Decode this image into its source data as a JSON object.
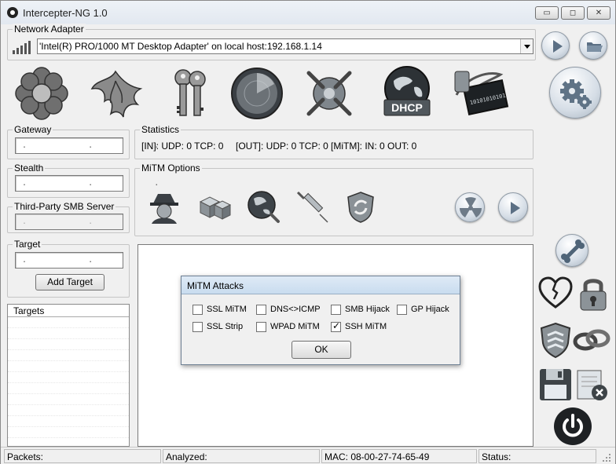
{
  "window": {
    "title": "Intercepter-NG 1.0",
    "controls": {
      "minimize_glyph": "▭",
      "maximize_glyph": "◻",
      "close_glyph": "✕"
    }
  },
  "network_adapter": {
    "label": "Network Adapter",
    "selected": "'Intel(R) PRO/1000 MT Desktop Adapter' on local host:192.168.1.14"
  },
  "ip_placeholder": ".      .      .",
  "gateway": {
    "label": "Gateway"
  },
  "stealth": {
    "label": "Stealth"
  },
  "third_party": {
    "label": "Third-Party SMB Server"
  },
  "target": {
    "label": "Target",
    "add_button": "Add Target"
  },
  "statistics": {
    "label": "Statistics",
    "in_text": "[IN]: UDP: 0 TCP: 0",
    "out_text": "[OUT]: UDP: 0 TCP: 0",
    "mitm_text": "[MiTM]: IN: 0 OUT: 0"
  },
  "mitm_options": {
    "label": "MiTM Options"
  },
  "targets_list": {
    "header": "Targets"
  },
  "dhcp_label": "DHCP",
  "binary_text": "10101010101",
  "status": {
    "packets": "Packets:",
    "analyzed": "Analyzed:",
    "mac": "MAC: 08-00-27-74-65-49",
    "status": "Status:"
  },
  "dialog": {
    "title": "MiTM Attacks",
    "options": [
      {
        "label": "SSL MiTM",
        "checked": false
      },
      {
        "label": "DNS<>ICMP",
        "checked": false
      },
      {
        "label": "SMB Hijack",
        "checked": false
      },
      {
        "label": "GP Hijack",
        "checked": false
      },
      {
        "label": "SSL Strip",
        "checked": false
      },
      {
        "label": "WPAD MiTM",
        "checked": false
      },
      {
        "label": "SSH MiTM",
        "checked": true
      }
    ],
    "ok_label": "OK",
    "check_glyph": "✓"
  }
}
